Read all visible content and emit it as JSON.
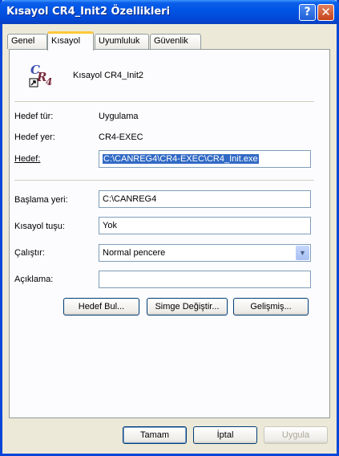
{
  "window": {
    "title": "Kısayol CR4_Init2 Özellikleri",
    "help_glyph": "?",
    "close_glyph": "✕"
  },
  "tabs": [
    {
      "label": "Genel"
    },
    {
      "label": "Kısayol"
    },
    {
      "label": "Uyumluluk"
    },
    {
      "label": "Güvenlik"
    }
  ],
  "shortcut": {
    "name": "Kısayol CR4_Init2",
    "icon_text": "CR4",
    "target_type_label": "Hedef tür:",
    "target_type_value": "Uygulama",
    "target_location_label": "Hedef yer:",
    "target_location_value": "CR4-EXEC",
    "target_label": "Hedef:",
    "target_value": "C:\\CANREG4\\CR4-EXEC\\CR4_Init.exe",
    "start_in_label": "Başlama yeri:",
    "start_in_value": "C:\\CANREG4",
    "hotkey_label": "Kısayol tuşu:",
    "hotkey_value": "Yok",
    "run_label": "Çalıştır:",
    "run_value": "Normal pencere",
    "comment_label": "Açıklama:",
    "comment_value": ""
  },
  "buttons": {
    "find_target": "Hedef Bul...",
    "change_icon": "Simge Değiştir...",
    "advanced": "Gelişmiş..."
  },
  "footer": {
    "ok": "Tamam",
    "cancel": "İptal",
    "apply": "Uygula"
  }
}
